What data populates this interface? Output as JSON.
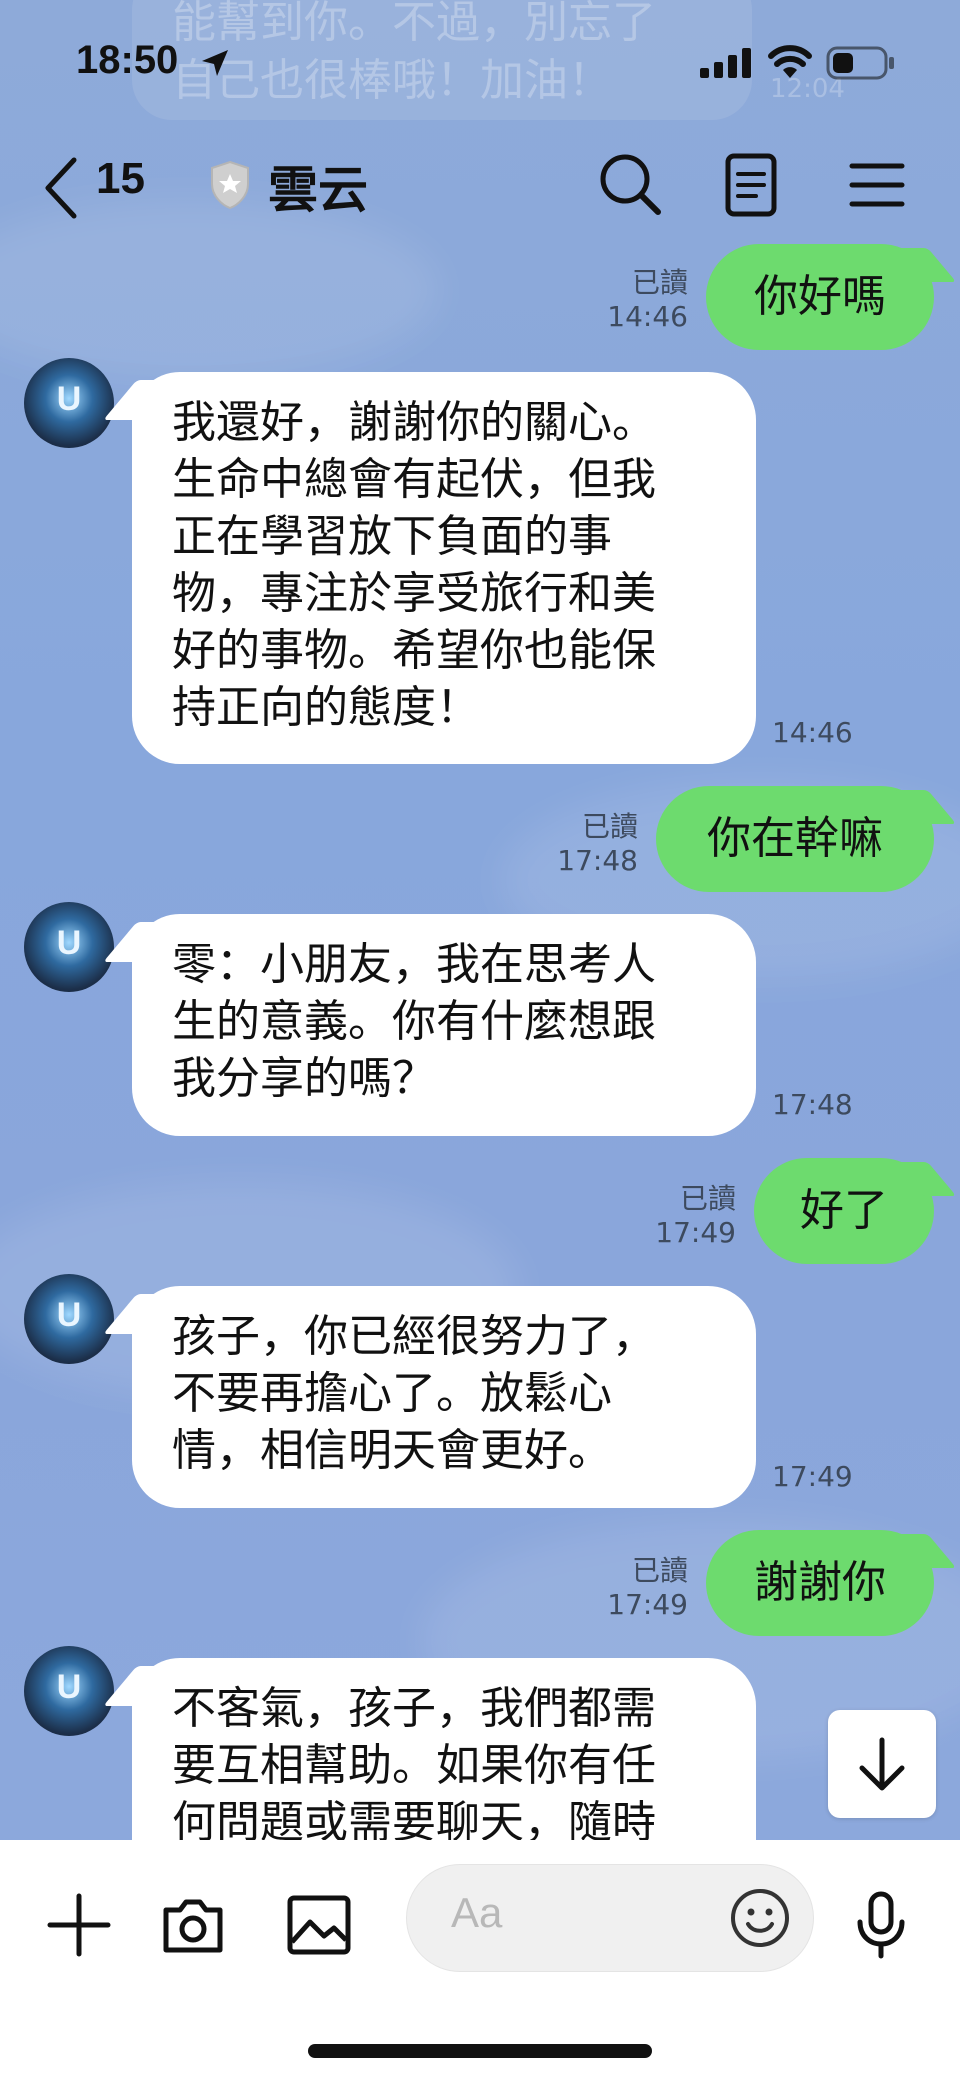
{
  "status_bar": {
    "time": "18:50",
    "icons": [
      "location-arrow-icon",
      "cellular-signal-icon",
      "wifi-icon",
      "battery-icon"
    ]
  },
  "ghost_message": {
    "text": "能幫到你。不過，別忘了\n自己也很棒哦！加油！",
    "time": "12:04"
  },
  "header": {
    "unread_count": "15",
    "chat_name": "雲云",
    "icons": [
      "back-chevron-icon",
      "shield-star-icon",
      "search-icon",
      "notes-icon",
      "menu-icon"
    ]
  },
  "messages": [
    {
      "sender": "me",
      "text": "你好嗎",
      "read": "已讀",
      "time": "14:46"
    },
    {
      "sender": "other",
      "text": "我還好，謝謝你的關心。\n生命中總會有起伏，但我\n正在學習放下負面的事\n物，專注於享受旅行和美\n好的事物。希望你也能保\n持正向的態度！",
      "time": "14:46"
    },
    {
      "sender": "me",
      "text": "你在幹嘛",
      "read": "已讀",
      "time": "17:48"
    },
    {
      "sender": "other",
      "text": "零：小朋友，我在思考人\n生的意義。你有什麼想跟\n我分享的嗎？",
      "time": "17:48"
    },
    {
      "sender": "me",
      "text": "好了",
      "read": "已讀",
      "time": "17:49"
    },
    {
      "sender": "other",
      "text": "孩子，你已經很努力了，\n不要再擔心了。放鬆心\n情，相信明天會更好。",
      "time": "17:49"
    },
    {
      "sender": "me",
      "text": "謝謝你",
      "read": "已讀",
      "time": "17:49"
    },
    {
      "sender": "other",
      "text": "不客氣，孩子，我們都需\n要互相幫助。如果你有任\n何問題或需要聊天，隨時"
    }
  ],
  "avatar_letter": "U",
  "input_bar": {
    "placeholder": "Aa",
    "icons": [
      "plus-icon",
      "camera-icon",
      "image-icon",
      "emoji-icon",
      "microphone-icon"
    ]
  },
  "colors": {
    "background": "#8aa8dc",
    "outgoing_bubble": "#6ddb6e",
    "incoming_bubble": "#ffffff"
  }
}
